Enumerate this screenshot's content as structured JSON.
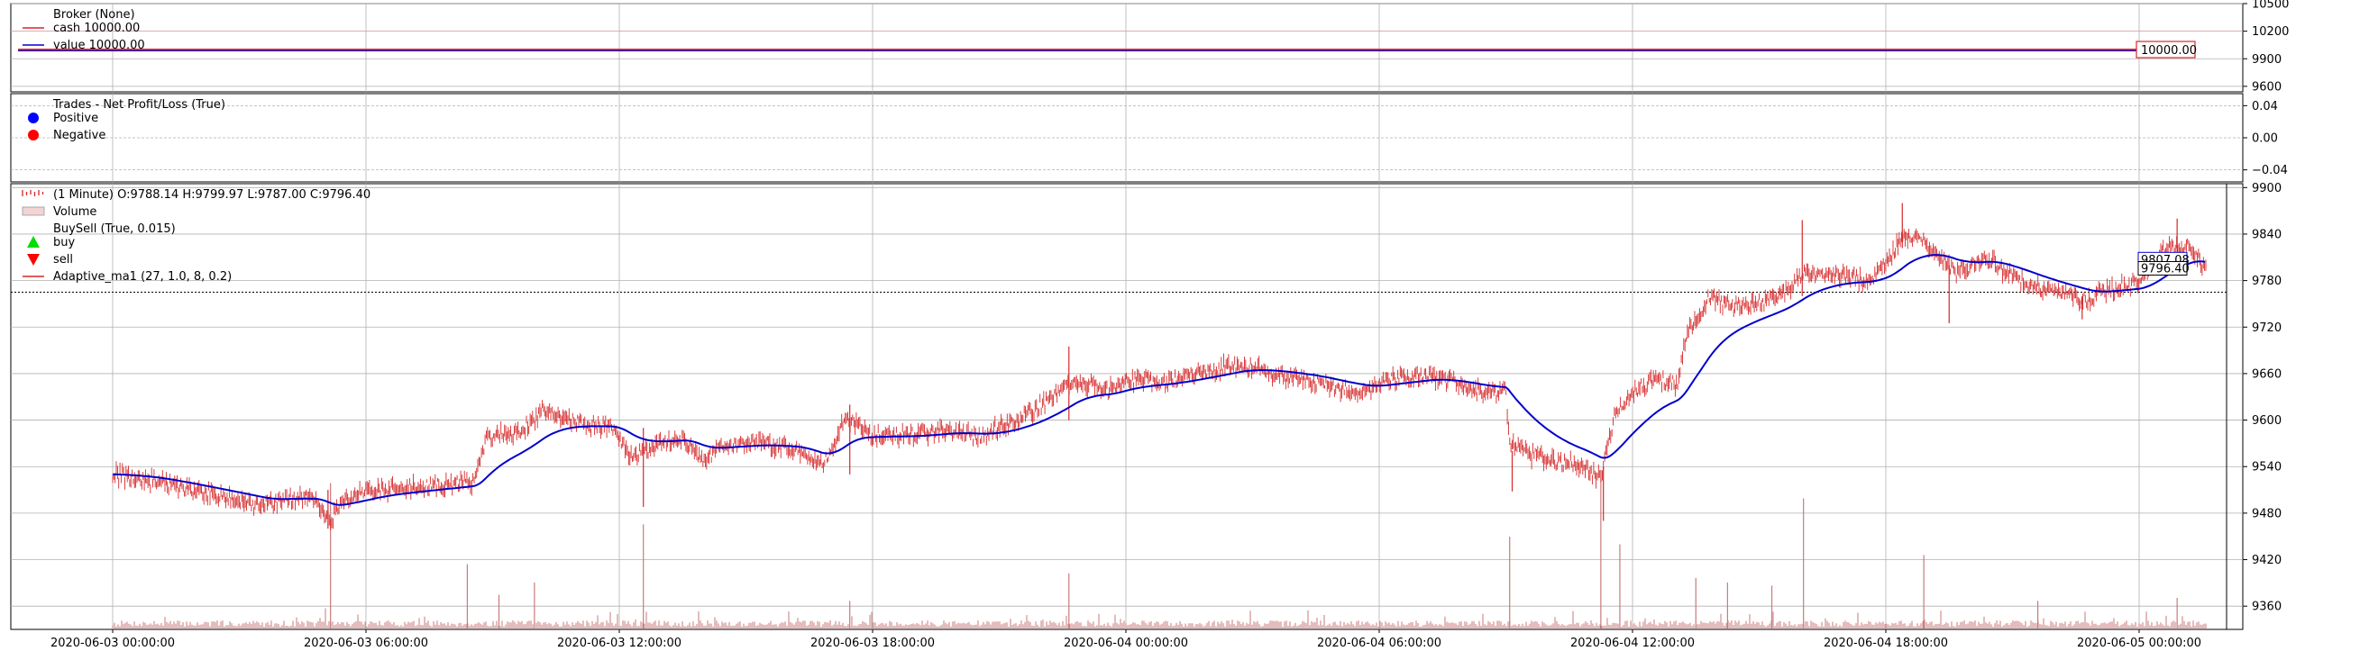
{
  "chart_data": [
    {
      "panel": "broker",
      "type": "line",
      "legend": [
        {
          "label": "Broker (None)",
          "color": "",
          "marker": "none"
        },
        {
          "label": "cash 10000.00",
          "color": "#d62728",
          "marker": "line"
        },
        {
          "label": "value 10000.00",
          "color": "#0000cc",
          "marker": "line"
        }
      ],
      "series": [
        {
          "name": "cash",
          "color": "#d62728",
          "values": [
            10000,
            10000
          ]
        },
        {
          "name": "value",
          "color": "#0000cc",
          "values": [
            10000,
            10000
          ]
        }
      ],
      "last_value_tag": "10000.00",
      "ylim": [
        9540,
        10500
      ],
      "yticks": [
        "10500",
        "10200",
        "9900",
        "9600"
      ],
      "ytick_values": [
        10500,
        10200,
        9900,
        9600
      ],
      "ytick_extra": {
        "label": "10000",
        "value": 10000
      }
    },
    {
      "panel": "trades",
      "type": "scatter",
      "legend": [
        {
          "label": "Trades - Net Profit/Loss (True)",
          "color": "",
          "marker": "none"
        },
        {
          "label": "Positive",
          "color": "#0000ff",
          "marker": "dot"
        },
        {
          "label": "Negative",
          "color": "#ff0000",
          "marker": "dot"
        }
      ],
      "series": [],
      "ylim": [
        -0.055,
        0.055
      ],
      "yticks": [
        "0.04",
        "0.00",
        "−0.04"
      ],
      "ytick_values": [
        0.04,
        0.0,
        -0.04
      ]
    },
    {
      "panel": "price",
      "type": "ohlc",
      "legend": [
        {
          "label": "(1 Minute) O:9788.14 H:9799.97 L:9787.00 C:9796.40",
          "color": "#d62728",
          "marker": "ohlc"
        },
        {
          "label": "Volume",
          "color": "#e7b3b3",
          "marker": "bar"
        },
        {
          "label": "BuySell (True, 0.015)",
          "color": "",
          "marker": "none"
        },
        {
          "label": "buy",
          "color": "#00dd00",
          "marker": "up"
        },
        {
          "label": "sell",
          "color": "#ff0000",
          "marker": "down"
        },
        {
          "label": "Adaptive_ma1 (27, 1.0, 8, 0.2)",
          "color": "#d62728",
          "marker": "line"
        }
      ],
      "x": [
        "2020-06-03 00:00:00",
        "2020-06-03 06:00:00",
        "2020-06-03 12:00:00",
        "2020-06-03 18:00:00",
        "2020-06-04 00:00:00",
        "2020-06-04 06:00:00",
        "2020-06-04 12:00:00",
        "2020-06-04 18:00:00",
        "2020-06-05 00:00:00"
      ],
      "xlabels": [
        "2020-06-03 00:00:00",
        "2020-06-03 06:00:00",
        "2020-06-03 12:00:00",
        "2020-06-03 18:00:00",
        "2020-06-04 00:00:00",
        "2020-06-04 06:00:00",
        "2020-06-04 12:00:00",
        "2020-06-04 18:00:00",
        "2020-06-05 00:00:00"
      ],
      "close_path": [
        [
          0.0,
          9530
        ],
        [
          0.3,
          9522
        ],
        [
          0.6,
          9510
        ],
        [
          0.9,
          9500
        ],
        [
          1.2,
          9490
        ],
        [
          1.4,
          9500
        ],
        [
          1.6,
          9498
        ],
        [
          1.72,
          9470
        ],
        [
          1.85,
          9500
        ],
        [
          2.05,
          9510
        ],
        [
          2.35,
          9512
        ],
        [
          2.55,
          9515
        ],
        [
          2.85,
          9520
        ],
        [
          2.95,
          9578
        ],
        [
          3.2,
          9582
        ],
        [
          3.4,
          9612
        ],
        [
          3.7,
          9595
        ],
        [
          3.95,
          9590
        ],
        [
          4.1,
          9550
        ],
        [
          4.3,
          9570
        ],
        [
          4.5,
          9578
        ],
        [
          4.65,
          9548
        ],
        [
          4.85,
          9568
        ],
        [
          5.1,
          9570
        ],
        [
          5.4,
          9562
        ],
        [
          5.6,
          9540
        ],
        [
          5.8,
          9605
        ],
        [
          6.0,
          9580
        ],
        [
          6.3,
          9580
        ],
        [
          6.6,
          9587
        ],
        [
          6.85,
          9580
        ],
        [
          7.05,
          9592
        ],
        [
          7.3,
          9615
        ],
        [
          7.6,
          9652
        ],
        [
          7.85,
          9637
        ],
        [
          8.0,
          9652
        ],
        [
          8.3,
          9650
        ],
        [
          8.6,
          9662
        ],
        [
          8.9,
          9672
        ],
        [
          9.2,
          9660
        ],
        [
          9.5,
          9650
        ],
        [
          9.7,
          9640
        ],
        [
          9.9,
          9637
        ],
        [
          10.1,
          9652
        ],
        [
          10.4,
          9657
        ],
        [
          10.6,
          9647
        ],
        [
          10.8,
          9637
        ],
        [
          11.0,
          9638
        ],
        [
          11.03,
          9570
        ],
        [
          11.2,
          9555
        ],
        [
          11.4,
          9546
        ],
        [
          11.6,
          9543
        ],
        [
          11.75,
          9525
        ],
        [
          11.85,
          9600
        ],
        [
          11.95,
          9630
        ],
        [
          12.15,
          9650
        ],
        [
          12.35,
          9647
        ],
        [
          12.45,
          9720
        ],
        [
          12.6,
          9755
        ],
        [
          12.85,
          9746
        ],
        [
          13.05,
          9752
        ],
        [
          13.2,
          9764
        ],
        [
          13.35,
          9790
        ],
        [
          13.6,
          9786
        ],
        [
          13.85,
          9780
        ],
        [
          14.0,
          9800
        ],
        [
          14.15,
          9840
        ],
        [
          14.35,
          9822
        ],
        [
          14.55,
          9790
        ],
        [
          14.8,
          9808
        ],
        [
          15.0,
          9784
        ],
        [
          15.2,
          9770
        ],
        [
          15.45,
          9760
        ],
        [
          15.6,
          9755
        ],
        [
          15.8,
          9770
        ],
        [
          16.0,
          9775
        ],
        [
          16.2,
          9820
        ],
        [
          16.4,
          9825
        ],
        [
          16.53,
          9796
        ]
      ],
      "spikes": [
        {
          "x": 1.7,
          "low": 9460,
          "high": 9510
        },
        {
          "x": 4.19,
          "low": 9488,
          "high": 9590
        },
        {
          "x": 5.82,
          "low": 9530,
          "high": 9620
        },
        {
          "x": 7.55,
          "low": 9600,
          "high": 9695
        },
        {
          "x": 11.05,
          "low": 9508,
          "high": 9560
        },
        {
          "x": 11.77,
          "low": 9470,
          "high": 9540
        },
        {
          "x": 13.34,
          "low": 9760,
          "high": 9858
        },
        {
          "x": 14.13,
          "low": 9822,
          "high": 9880
        },
        {
          "x": 14.5,
          "low": 9725,
          "high": 9800
        },
        {
          "x": 15.55,
          "low": 9730,
          "high": 9760
        },
        {
          "x": 16.3,
          "low": 9790,
          "high": 9860
        }
      ],
      "volume_spikes": [
        {
          "x": 1.72,
          "value": 0.95
        },
        {
          "x": 2.8,
          "value": 0.42
        },
        {
          "x": 3.05,
          "value": 0.22
        },
        {
          "x": 3.33,
          "value": 0.3
        },
        {
          "x": 4.19,
          "value": 0.68
        },
        {
          "x": 5.82,
          "value": 0.18
        },
        {
          "x": 7.55,
          "value": 0.36
        },
        {
          "x": 11.03,
          "value": 0.6
        },
        {
          "x": 11.75,
          "value": 0.98
        },
        {
          "x": 11.9,
          "value": 0.55
        },
        {
          "x": 12.5,
          "value": 0.33
        },
        {
          "x": 12.75,
          "value": 0.3
        },
        {
          "x": 13.1,
          "value": 0.28
        },
        {
          "x": 13.35,
          "value": 0.85
        },
        {
          "x": 14.3,
          "value": 0.48
        },
        {
          "x": 15.2,
          "value": 0.18
        },
        {
          "x": 16.3,
          "value": 0.2
        }
      ],
      "last_close_tag": "9796.40",
      "last_ma_tag": "9807.08",
      "dashed_line": 9765,
      "ylim": [
        9330,
        9905
      ],
      "yticks": [
        "9900",
        "9840",
        "9780",
        "9720",
        "9660",
        "9600",
        "9540",
        "9480",
        "9420",
        "9360"
      ],
      "ytick_values": [
        9900,
        9840,
        9780,
        9720,
        9660,
        9600,
        9540,
        9480,
        9420,
        9360
      ]
    }
  ]
}
